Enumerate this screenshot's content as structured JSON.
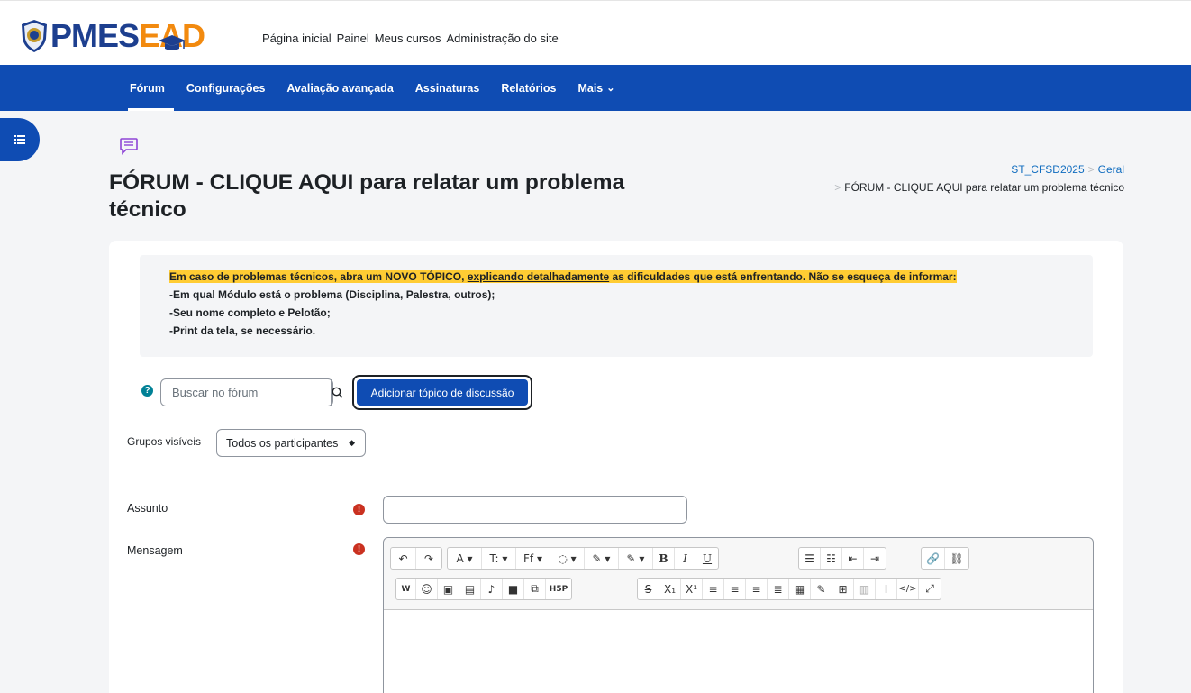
{
  "brand": {
    "name_part1": "PMES",
    "name_part2": "EAD"
  },
  "top_nav": [
    "Página inicial",
    "Painel",
    "Meus cursos",
    "Administração do site"
  ],
  "secondary_nav": {
    "items": [
      "Fórum",
      "Configurações",
      "Avaliação avançada",
      "Assinaturas",
      "Relatórios",
      "Mais"
    ],
    "active": "Fórum"
  },
  "page": {
    "title": "FÓRUM - CLIQUE AQUI para relatar um problema técnico"
  },
  "breadcrumb": {
    "course": "ST_CFSD2025",
    "section": "Geral",
    "current": "FÓRUM - CLIQUE AQUI para relatar um problema técnico"
  },
  "intro": {
    "line1_a": "Em caso de problemas técnicos, abra um NOVO TÓPICO, ",
    "line1_b": "explicando detalhadamente",
    "line1_c": " as dificuldades que está enfrentando. Não se esqueça de informar:",
    "line2": "-Em qual Módulo está o problema (Disciplina, Palestra, outros);",
    "line3": "-Seu nome completo e Pelotão;",
    "line4": "-Print da tela, se necessário."
  },
  "search": {
    "placeholder": "Buscar no fórum"
  },
  "add_topic_button": "Adicionar tópico de discussão",
  "groups": {
    "label": "Grupos visíveis",
    "selected": "Todos os participantes"
  },
  "form": {
    "subject_label": "Assunto",
    "subject_value": "",
    "message_label": "Mensagem",
    "required_mark": "!"
  },
  "editor_toolbar": {
    "row1": [
      "↶",
      "↷",
      "A ▾",
      "T: ▾",
      "Ff ▾",
      "◌ ▾",
      "✎ ▾",
      "✎ ▾",
      "B",
      "I",
      "U",
      "☰",
      "☷",
      "⇤",
      "⇥",
      "🔗",
      "⛓"
    ],
    "row2": [
      "W",
      "☺",
      "▣",
      "▤",
      "♪",
      "■",
      "⧉",
      "H5P",
      "S",
      "X₁",
      "X¹",
      "≡",
      "≡",
      "≡",
      "≣",
      "▦",
      "✎",
      "⊞",
      "▥",
      "I",
      "</>",
      "⤢"
    ]
  },
  "colors": {
    "brand_blue": "#0f4cb3",
    "brand_orange": "#f28a0f",
    "highlight": "#ffcc33",
    "required_red": "#ca3120",
    "help_teal": "#008196"
  }
}
